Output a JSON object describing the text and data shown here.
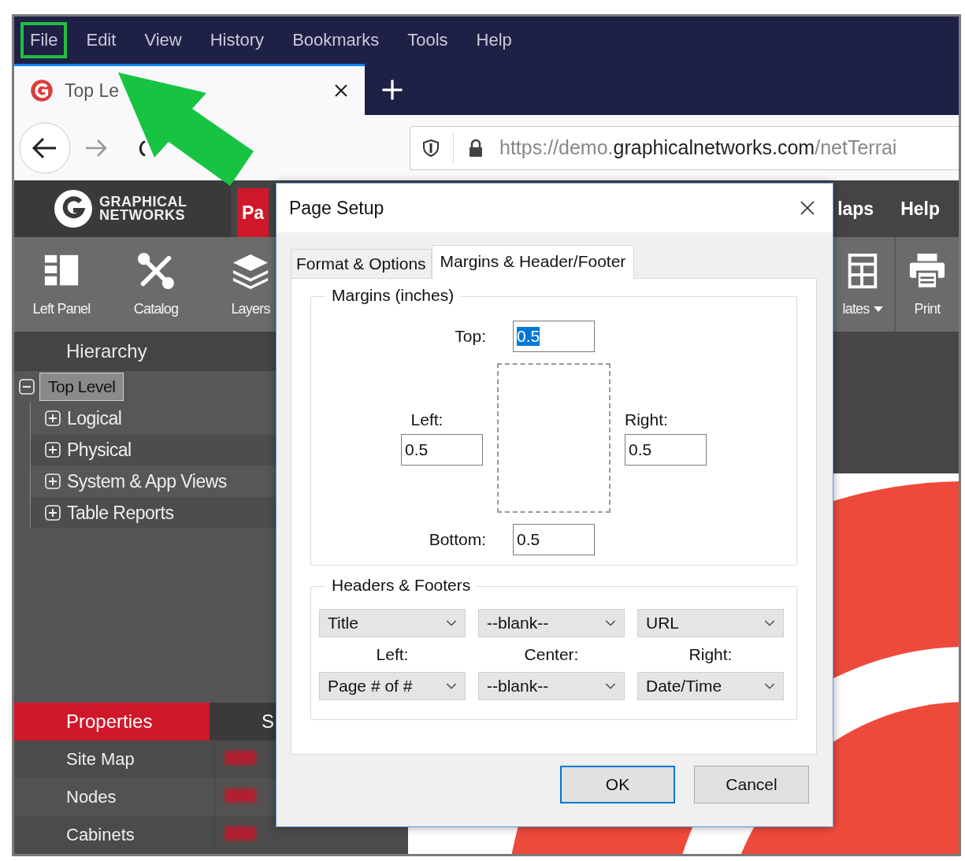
{
  "browser": {
    "menu": [
      {
        "label": "File",
        "highlighted": true
      },
      {
        "label": "Edit",
        "highlighted": false
      },
      {
        "label": "View",
        "highlighted": false
      },
      {
        "label": "History",
        "highlighted": false
      },
      {
        "label": "Bookmarks",
        "highlighted": false
      },
      {
        "label": "Tools",
        "highlighted": false
      },
      {
        "label": "Help",
        "highlighted": false
      }
    ],
    "tabs": [
      {
        "title": "Top Le",
        "selected": true
      }
    ],
    "url": {
      "prefix": "https://demo.",
      "domain": "graphicalnetworks.com",
      "path": "/netTerrai"
    }
  },
  "app": {
    "logo": {
      "line1": "GRAPHICAL",
      "line2": "NETWORKS"
    },
    "nav_left": [
      {
        "label": "Pa",
        "selected": true
      }
    ],
    "nav_right": [
      {
        "label": "laps",
        "selected": false
      },
      {
        "label": "Help",
        "selected": false
      }
    ],
    "toolbar_left": [
      {
        "label": "Left Panel",
        "kind": "panel",
        "dropdown": false
      },
      {
        "label": "Catalog",
        "kind": "tools",
        "dropdown": false
      },
      {
        "label": "Layers",
        "kind": "layers",
        "dropdown": false
      }
    ],
    "toolbar_right": [
      {
        "label": "lates",
        "kind": "template",
        "dropdown": true
      },
      {
        "label": "Print",
        "kind": "print",
        "dropdown": false
      }
    ],
    "hierarchy": {
      "title": "Hierarchy",
      "tree": [
        {
          "label": "Top Level",
          "expanded": true,
          "selected": true,
          "children": [
            {
              "label": "Logical",
              "expanded": false,
              "selected": false
            },
            {
              "label": "Physical",
              "expanded": false,
              "selected": false
            },
            {
              "label": "System & App Views",
              "expanded": false,
              "selected": false
            },
            {
              "label": "Table Reports",
              "expanded": false,
              "selected": false
            }
          ]
        }
      ]
    },
    "properties": {
      "tabs": [
        {
          "label": "Properties",
          "selected": true
        },
        {
          "label": "S",
          "selected": false
        }
      ],
      "rows": [
        {
          "name": "Site Map"
        },
        {
          "name": "Nodes"
        },
        {
          "name": "Cabinets"
        }
      ]
    }
  },
  "dialog": {
    "title": "Page Setup",
    "tabs": [
      {
        "label": "Format & Options",
        "selected": false
      },
      {
        "label": "Margins & Header/Footer",
        "selected": true
      }
    ],
    "margins": {
      "title": "Margins (inches)",
      "top": {
        "label": "Top:",
        "value": "0.5",
        "selected": true
      },
      "left": {
        "label": "Left:",
        "value": "0.5",
        "selected": false
      },
      "right": {
        "label": "Right:",
        "value": "0.5",
        "selected": false
      },
      "bottom": {
        "label": "Bottom:",
        "value": "0.5",
        "selected": false
      }
    },
    "headers_footers": {
      "title": "Headers & Footers",
      "header": [
        {
          "value": "Title"
        },
        {
          "value": "--blank--"
        },
        {
          "value": "URL"
        }
      ],
      "labels": [
        "Left:",
        "Center:",
        "Right:"
      ],
      "footer": [
        {
          "value": "Page # of #"
        },
        {
          "value": "--blank--"
        },
        {
          "value": "Date/Time"
        }
      ]
    },
    "buttons": [
      {
        "label": "OK",
        "default": true
      },
      {
        "label": "Cancel",
        "default": false
      }
    ]
  }
}
